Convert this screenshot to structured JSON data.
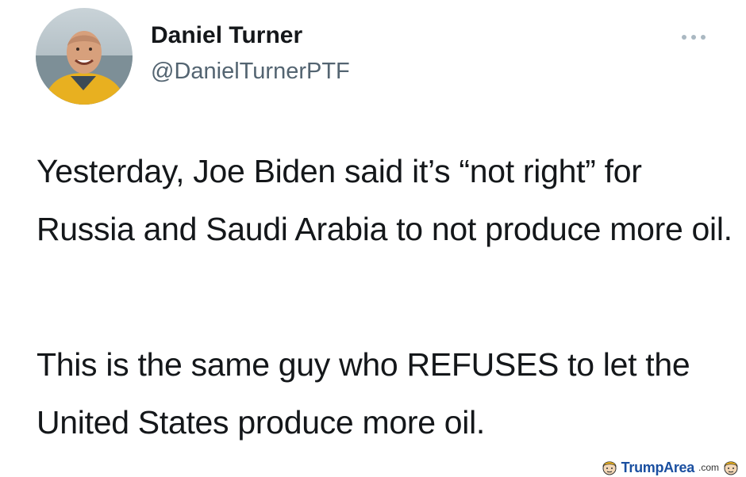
{
  "tweet": {
    "author": {
      "name": "Daniel Turner",
      "handle": "@DanielTurnerPTF",
      "avatar_icon": "profile-photo"
    },
    "more_icon": "ellipsis-icon",
    "paragraphs": [
      "Yesterday, Joe Biden said it’s “not right” for Russia and Saudi Arabia to not produce more oil.",
      "This is the same guy who REFUSES to let the United States produce more oil."
    ]
  },
  "watermark": {
    "brand": "TrumpArea",
    "suffix": ".com",
    "colors": {
      "brand": "#1a4fa0"
    }
  }
}
